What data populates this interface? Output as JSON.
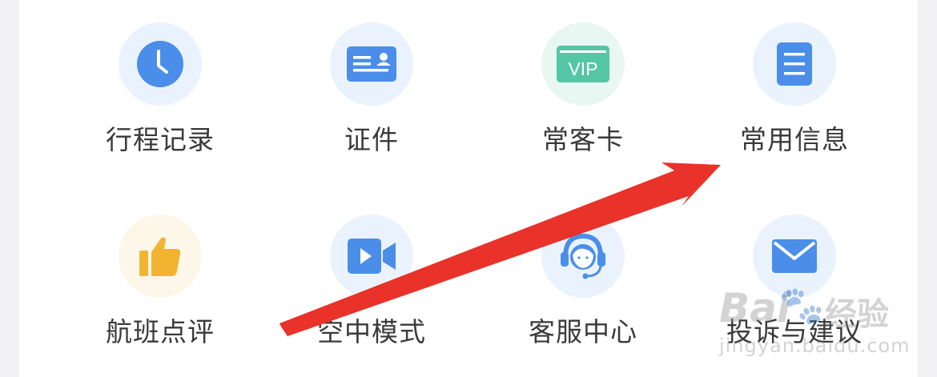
{
  "menu": [
    {
      "label": "行程记录",
      "icon": "clock-icon",
      "color": "#4a8ee9",
      "bg": "#eaf3fd"
    },
    {
      "label": "证件",
      "icon": "id-card-icon",
      "color": "#4a8ee9",
      "bg": "#eaf3fd"
    },
    {
      "label": "常客卡",
      "icon": "vip-card-icon",
      "text": "VIP",
      "color": "#54c6a4",
      "bg": "#e8f7f2"
    },
    {
      "label": "常用信息",
      "icon": "document-icon",
      "color": "#4a8ee9",
      "bg": "#eaf3fd"
    },
    {
      "label": "航班点评",
      "icon": "thumbs-up-icon",
      "color": "#f2b430",
      "bg": "#fdf7e9"
    },
    {
      "label": "空中模式",
      "icon": "video-camera-icon",
      "color": "#4a8ee9",
      "bg": "#eaf3fd"
    },
    {
      "label": "客服中心",
      "icon": "headset-agent-icon",
      "color": "#4a8ee9",
      "bg": "#eaf3fd"
    },
    {
      "label": "投诉与建议",
      "icon": "envelope-icon",
      "color": "#4a8ee9",
      "bg": "#eaf3fd"
    }
  ],
  "annotation": {
    "color": "#e8322a"
  },
  "watermark": {
    "logo": "Bai",
    "brand": "经验",
    "url": "jingyan.baidu.com"
  }
}
